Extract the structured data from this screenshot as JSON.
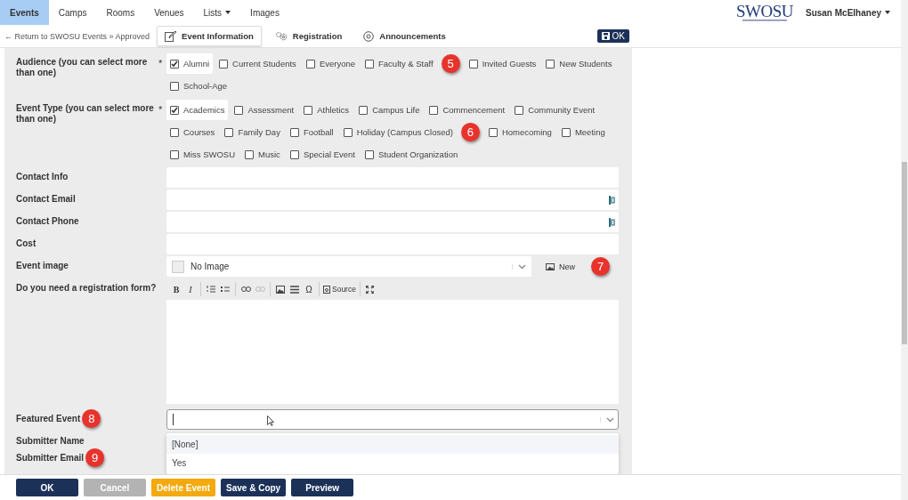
{
  "nav": {
    "tabs": [
      {
        "label": "Events",
        "selected": true
      },
      {
        "label": "Camps",
        "selected": false
      },
      {
        "label": "Rooms",
        "selected": false
      },
      {
        "label": "Venues",
        "selected": false
      },
      {
        "label": "Lists",
        "selected": false,
        "dropdown": true
      },
      {
        "label": "Images",
        "selected": false
      }
    ],
    "logo": "SWOSU",
    "user": "Susan McElhaney"
  },
  "subnav": {
    "back": "← Return to SWOSU Events » Approved",
    "tabs": [
      {
        "label": "Event Information",
        "selected": true
      },
      {
        "label": "Registration",
        "selected": false
      },
      {
        "label": "Announcements",
        "selected": false
      }
    ],
    "ok": "OK"
  },
  "form": {
    "rows": [
      {
        "kind": "checkboxes",
        "label": "Audience (you can select more than one)",
        "required": "*",
        "options": [
          {
            "label": "Alumni",
            "checked": true
          },
          {
            "label": "Current Students",
            "checked": false
          },
          {
            "label": "Everyone",
            "checked": false
          },
          {
            "label": "Faculty & Staff",
            "checked": false,
            "callout": "5"
          },
          {
            "label": "Invited Guests",
            "checked": false
          },
          {
            "label": "New Students",
            "checked": false
          },
          {
            "label": "School-Age",
            "checked": false
          }
        ]
      },
      {
        "kind": "checkboxes",
        "label": "Event Type (you can select more than one)",
        "required": "*",
        "options": [
          {
            "label": "Academics",
            "checked": true
          },
          {
            "label": "Assessment",
            "checked": false
          },
          {
            "label": "Athletics",
            "checked": false
          },
          {
            "label": "Campus Life",
            "checked": false
          },
          {
            "label": "Commencement",
            "checked": false
          },
          {
            "label": "Community Event",
            "checked": false
          },
          {
            "label": "Courses",
            "checked": false
          },
          {
            "label": "Family Day",
            "checked": false
          },
          {
            "label": "Football",
            "checked": false
          },
          {
            "label": "Holiday (Campus Closed)",
            "checked": false,
            "callout": "6"
          },
          {
            "label": "Homecoming",
            "checked": false
          },
          {
            "label": "Meeting",
            "checked": false
          },
          {
            "label": "Miss SWOSU",
            "checked": false
          },
          {
            "label": "Music",
            "checked": false
          },
          {
            "label": "Special Event",
            "checked": false
          },
          {
            "label": "Student Organization",
            "checked": false
          }
        ]
      },
      {
        "kind": "text",
        "label": "Contact Info"
      },
      {
        "kind": "lookup",
        "label": "Contact Email"
      },
      {
        "kind": "lookup",
        "label": "Contact Phone"
      },
      {
        "kind": "text",
        "label": "Cost"
      },
      {
        "kind": "image",
        "label": "Event image",
        "value": "No Image",
        "button": "New",
        "callout": "7"
      },
      {
        "kind": "editor",
        "label": "Do you need a registration form?",
        "toolbar": [
          {
            "items": [
              {
                "kind": "bold",
                "label": "B"
              },
              {
                "kind": "italic",
                "label": "I"
              }
            ]
          },
          {
            "items": [
              {
                "kind": "numbered-list"
              },
              {
                "kind": "bulleted-list"
              }
            ]
          },
          {
            "items": [
              {
                "kind": "link"
              },
              {
                "kind": "unlink",
                "disabled": true
              }
            ]
          },
          {
            "items": [
              {
                "kind": "image"
              },
              {
                "kind": "rule"
              },
              {
                "kind": "symbol",
                "label": "Ω"
              }
            ]
          },
          {
            "items": [
              {
                "kind": "source",
                "label": "Source"
              }
            ]
          },
          {
            "items": [
              {
                "kind": "maximize"
              }
            ]
          }
        ]
      },
      {
        "kind": "select",
        "label": "Featured Event",
        "open": true,
        "callout": "8",
        "options": [
          {
            "label": "[None]",
            "selected": true
          },
          {
            "label": "Yes",
            "selected": false
          }
        ]
      },
      {
        "kind": "covered",
        "label": "Submitter Name"
      },
      {
        "kind": "covered",
        "label": "Submitter Email",
        "callout": "9"
      }
    ]
  },
  "buttons": [
    {
      "label": "OK",
      "kind": "primary"
    },
    {
      "label": "Cancel",
      "kind": "disabled"
    },
    {
      "label": "Delete Event",
      "kind": "danger"
    },
    {
      "label": "Save & Copy",
      "kind": "primary"
    },
    {
      "label": "Preview",
      "kind": "primary"
    }
  ]
}
